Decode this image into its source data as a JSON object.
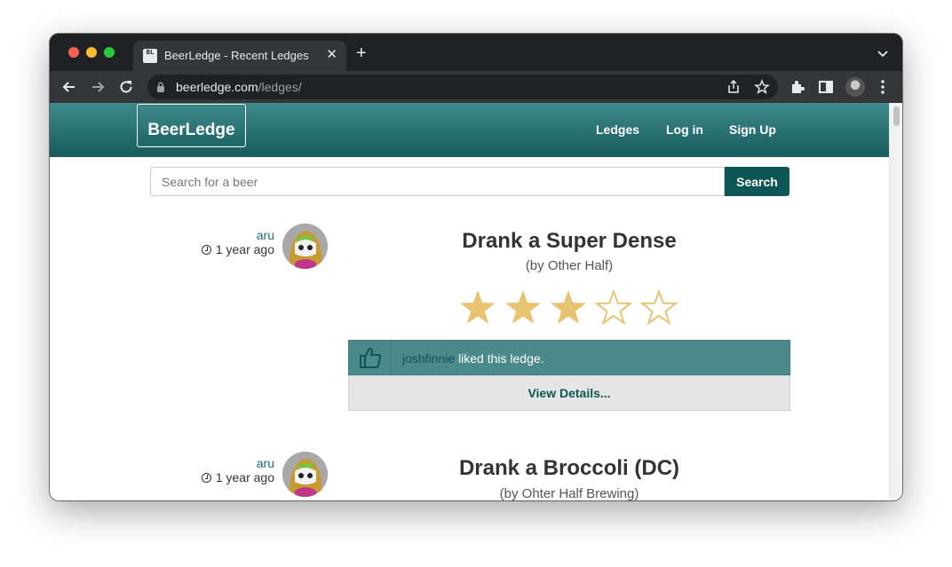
{
  "browser": {
    "tab_title": "BeerLedge - Recent Ledges",
    "tab_favicon_text": "BL",
    "url_host": "beerledge.com",
    "url_path": "/ledges/",
    "icons": [
      "back-icon",
      "forward-icon",
      "reload-icon",
      "lock-icon",
      "share-icon",
      "bookmark-star-icon",
      "extensions-icon",
      "sidebar-icon",
      "profile-avatar",
      "menu-icon"
    ]
  },
  "site": {
    "brand": "BeerLedge",
    "nav": [
      {
        "label": "Ledges"
      },
      {
        "label": "Log in"
      },
      {
        "label": "Sign Up"
      }
    ],
    "search": {
      "placeholder": "Search for a beer",
      "button_label": "Search"
    },
    "colors": {
      "navbar_top": "#3f8b8c",
      "navbar_bottom": "#175a5c",
      "accent": "#0e5556",
      "star_fill": "#e8c472"
    }
  },
  "ledges": [
    {
      "user": "aru",
      "time": "1 year ago",
      "title": "Drank a Super Dense",
      "brewery": "(by Other Half)",
      "rating": 3,
      "rating_max": 5,
      "like_user": "joshfinnie",
      "like_text": " liked this ledge.",
      "details_label": "View Details..."
    },
    {
      "user": "aru",
      "time": "1 year ago",
      "title": "Drank a Broccoli (DC)",
      "brewery": "(by Ohter Half Brewing)"
    }
  ]
}
